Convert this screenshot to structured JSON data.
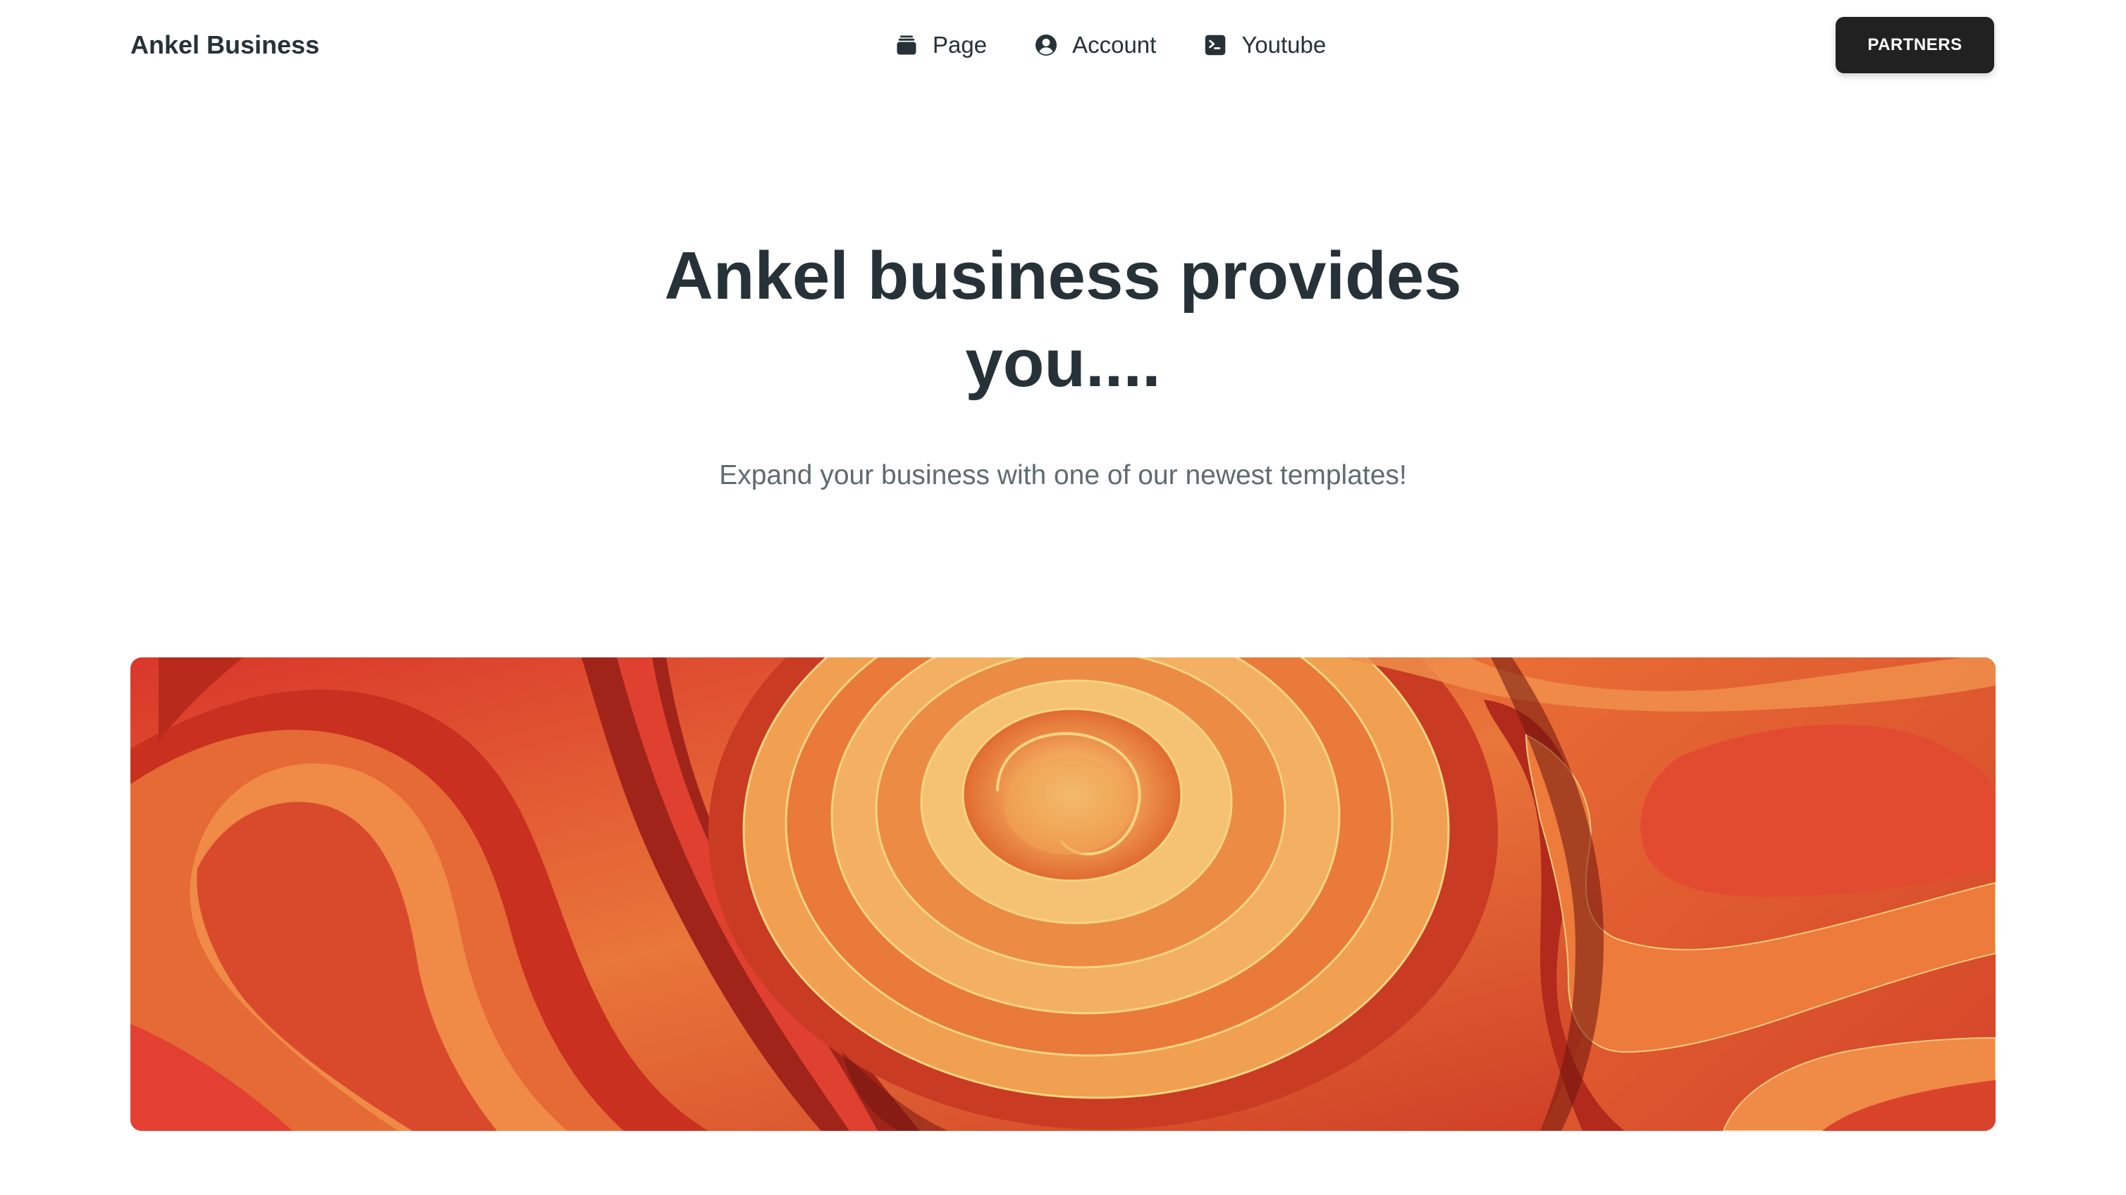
{
  "navbar": {
    "brand": "Ankel Business",
    "links": [
      {
        "label": "Page",
        "icon": "wallet-icon"
      },
      {
        "label": "Account",
        "icon": "user-circle-icon"
      },
      {
        "label": "Youtube",
        "icon": "terminal-icon"
      }
    ],
    "cta_label": "PARTNERS"
  },
  "hero": {
    "title_line1": "Ankel business provides",
    "title_line2": "you....",
    "subtitle": "Expand your business with one of our newest templates!"
  },
  "banner": {
    "image": "abstract-orange-spiral-image",
    "colors": {
      "deep_red": "#9c1f13",
      "red": "#d9372a",
      "orange": "#e9763a",
      "light_orange": "#f2a55a",
      "yellow": "#f7d483"
    }
  },
  "theme": {
    "text_dark": "#263238",
    "text_muted": "#5f6b70",
    "button_bg": "#212121",
    "button_text": "#ffffff",
    "background": "#ffffff"
  }
}
